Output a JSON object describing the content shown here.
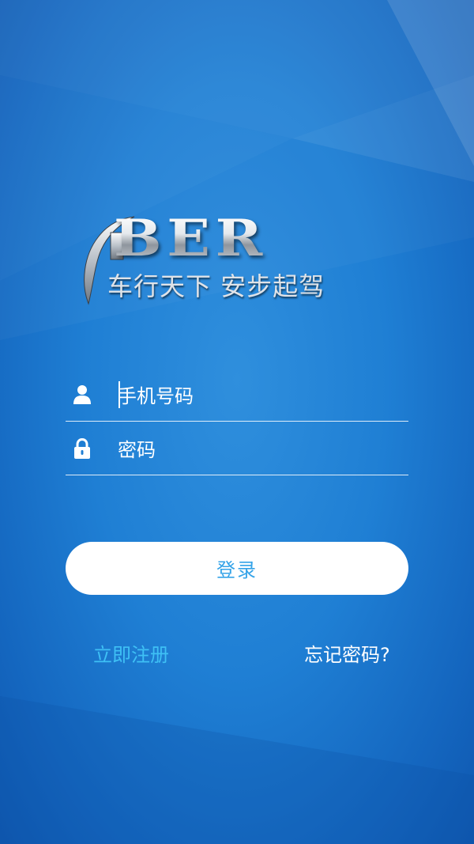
{
  "logo": {
    "wordmark": "BER",
    "slogan": "车行天下 安步起驾"
  },
  "form": {
    "phone": {
      "placeholder": "手机号码",
      "value": "",
      "icon": "user-icon"
    },
    "password": {
      "placeholder": "密码",
      "value": "",
      "icon": "lock-icon"
    }
  },
  "actions": {
    "login_label": "登录",
    "register_label": "立即注册",
    "forgot_label": "忘记密码?"
  },
  "colors": {
    "background": "#1f7fd4",
    "button_text": "#34a3e8",
    "register_link": "#3ec0f5",
    "text": "#ffffff"
  }
}
